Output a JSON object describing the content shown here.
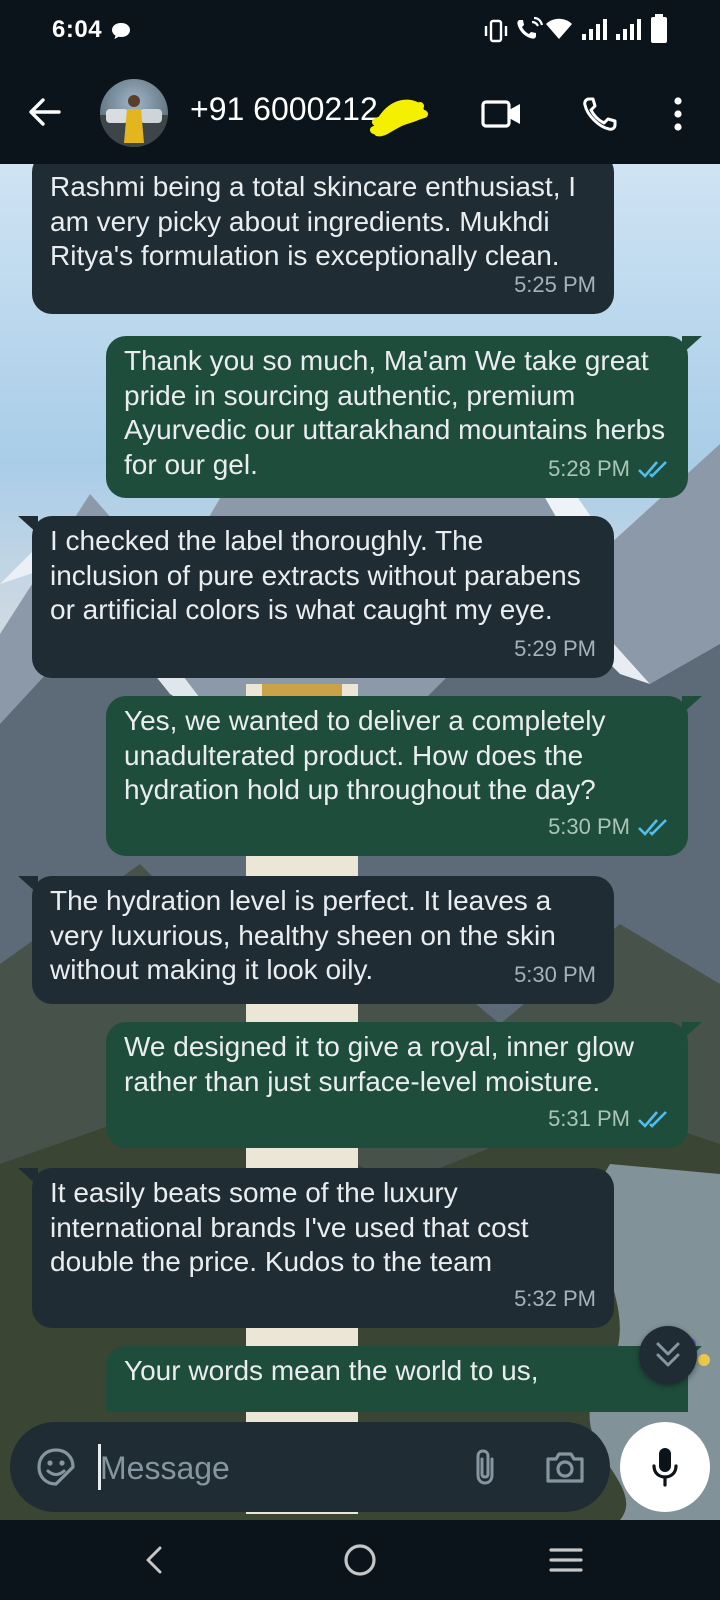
{
  "status_bar": {
    "time": "6:04"
  },
  "header": {
    "contact_name": "+91 6000212"
  },
  "messages": [
    {
      "direction": "in",
      "text": "Rashmi being a total skincare enthusiast, I am very picky about ingredients. Mukhdi Ritya's formulation is exceptionally clean.",
      "time": "5:25 PM"
    },
    {
      "direction": "out",
      "text": "Thank you so much, Ma'am We take great pride in sourcing authentic, premium Ayurvedic our uttarakhand mountains herbs for our gel.",
      "time": "5:28 PM",
      "status": "read"
    },
    {
      "direction": "in",
      "text": "I checked the label thoroughly. The inclusion of pure extracts without parabens or artificial colors is what caught my eye.",
      "time": "5:29 PM"
    },
    {
      "direction": "out",
      "text": "Yes, we wanted to deliver a completely unadulterated product. How does the hydration hold up throughout the day?",
      "time": "5:30 PM",
      "status": "read"
    },
    {
      "direction": "in",
      "text": "The hydration level is perfect. It leaves a very luxurious, healthy sheen on the skin without making it look oily.",
      "time": "5:30 PM"
    },
    {
      "direction": "out",
      "text": "We designed it to give a royal, inner glow rather than just surface-level moisture.",
      "time": "5:31 PM",
      "status": "read"
    },
    {
      "direction": "in",
      "text": "It easily beats some of the luxury international brands I've used that cost double the price. Kudos to the team",
      "time": "5:32 PM"
    },
    {
      "direction": "out",
      "text": "Your words mean the world to us,",
      "time": ""
    }
  ],
  "composer": {
    "placeholder": "Message"
  },
  "colors": {
    "incoming_bubble": "#202c33",
    "outgoing_bubble": "#1f4d3c",
    "read_tick": "#53bdeb",
    "background": "#0b141a"
  },
  "icons": [
    "back-arrow-icon",
    "video-call-icon",
    "voice-call-icon",
    "more-options-icon",
    "emoji-icon",
    "attach-icon",
    "camera-icon",
    "mic-icon",
    "double-chevron-down-icon",
    "read-receipt-icon"
  ]
}
